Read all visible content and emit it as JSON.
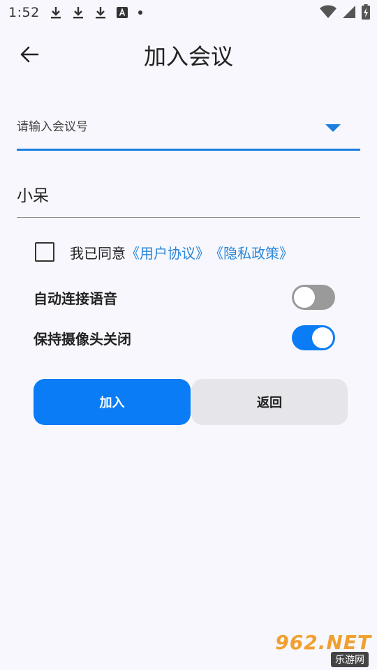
{
  "status_bar": {
    "time": "1:52",
    "left_icons": [
      "download-icon",
      "download-icon",
      "download-icon",
      "text-a-icon",
      "dot-icon"
    ],
    "right_icons": [
      "wifi-icon",
      "signal-icon",
      "battery-charging-icon"
    ]
  },
  "header": {
    "title": "加入会议",
    "back_icon": "arrow-left-icon"
  },
  "meeting_number": {
    "placeholder": "请输入会议号",
    "value": "",
    "accent_color": "#1a7fe0"
  },
  "name_field": {
    "value": "小呆"
  },
  "agreement": {
    "checked": false,
    "text": "我已同意",
    "user_agreement_link": "《用户协议》",
    "privacy_policy_link": "《隐私政策》"
  },
  "options": {
    "auto_audio": {
      "label": "自动连接语音",
      "on": false
    },
    "camera_off": {
      "label": "保持摄像头关闭",
      "on": true
    }
  },
  "buttons": {
    "join_label": "加入",
    "back_label": "返回"
  },
  "watermark": {
    "main": "962.NET",
    "sub": "乐游网"
  },
  "colors": {
    "primary": "#0a7cf5",
    "link": "#2a86d9",
    "background": "#f7f7fd"
  }
}
